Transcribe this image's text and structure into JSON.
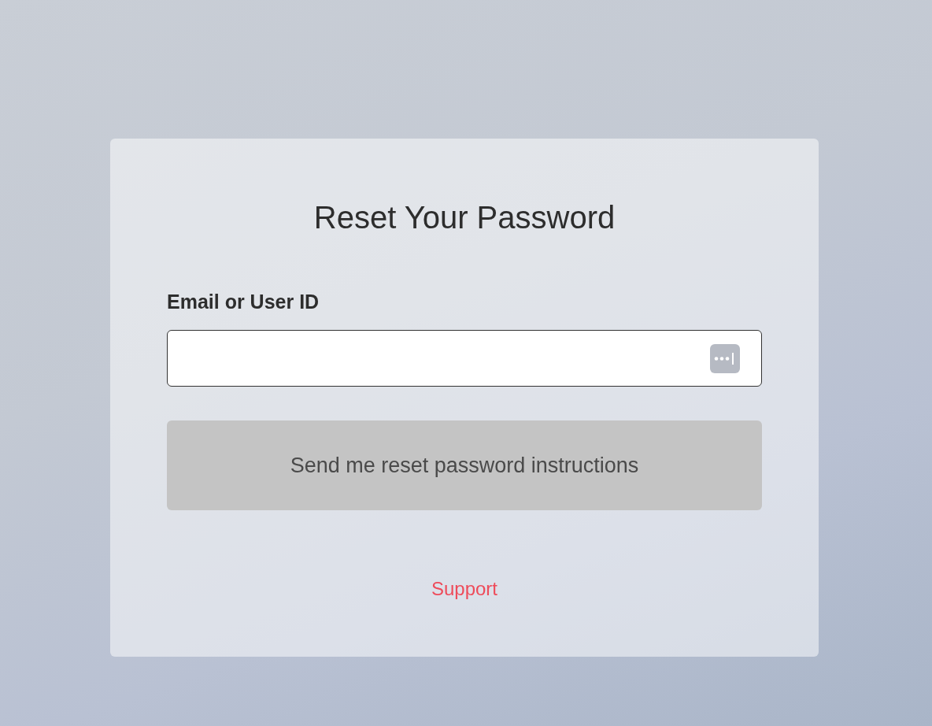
{
  "title": "Reset Your Password",
  "email_field": {
    "label": "Email or User ID"
  },
  "submit_button": {
    "label": "Send me reset password instructions",
    "disabled": true
  },
  "support_link": "Support"
}
